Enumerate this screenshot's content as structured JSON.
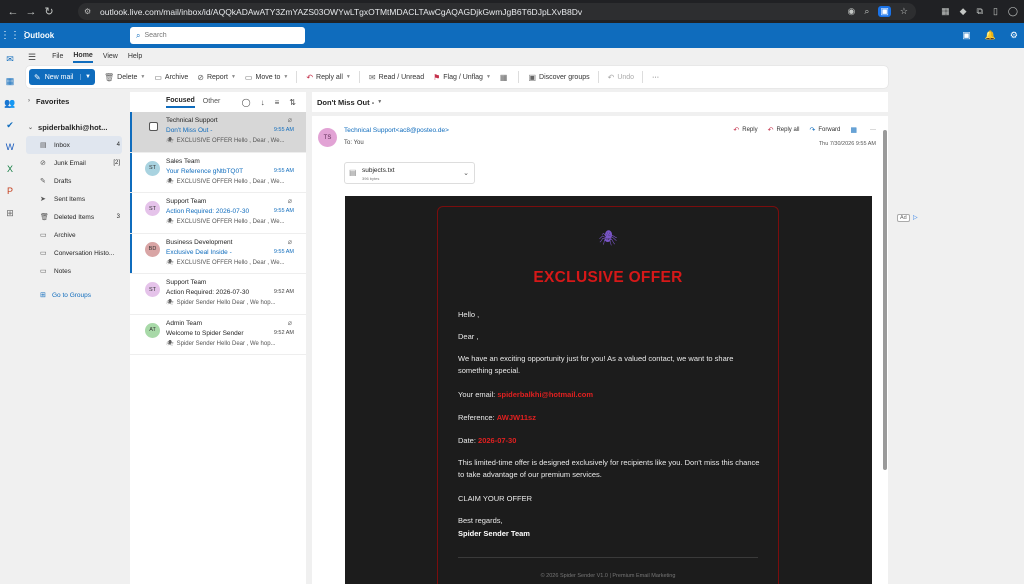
{
  "browser": {
    "url": "outlook.live.com/mail/inbox/id/AQQkADAwATY3ZmYAZS03OWYwLTgxOTMtMDACLTAwCgAQAGDjkGwmJgB6T6DJpLXvB8Dv",
    "back": "←",
    "forward": "→",
    "reload": "↻",
    "tune": "⚙"
  },
  "app": {
    "brand": "Outlook",
    "search_placeholder": "Search"
  },
  "menu_tabs": [
    "File",
    "Home",
    "View",
    "Help"
  ],
  "toolbar": {
    "new_mail": "New mail",
    "delete": "Delete",
    "archive": "Archive",
    "report": "Report",
    "move_to": "Move to",
    "reply_all": "Reply all",
    "read_unread": "Read / Unread",
    "flag_unflag": "Flag / Unflag",
    "discover_groups": "Discover groups",
    "undo": "Undo",
    "more": "···"
  },
  "folders": {
    "favorites": "Favorites",
    "account": "spiderbalkhi@hot...",
    "items": [
      {
        "label": "Inbox",
        "count": "4",
        "icon": "inbox-icon",
        "glyph": "▤"
      },
      {
        "label": "Junk Email",
        "count": "[2]",
        "icon": "junk-icon",
        "glyph": "⊘"
      },
      {
        "label": "Drafts",
        "count": "",
        "icon": "drafts-icon",
        "glyph": "✎"
      },
      {
        "label": "Sent Items",
        "count": "",
        "icon": "sent-icon",
        "glyph": "➤"
      },
      {
        "label": "Deleted Items",
        "count": "3",
        "icon": "trash-icon",
        "glyph": "🗑"
      },
      {
        "label": "Archive",
        "count": "",
        "icon": "archive-icon",
        "glyph": "▭"
      },
      {
        "label": "Conversation Histo...",
        "count": "",
        "icon": "folder-icon",
        "glyph": "▭"
      },
      {
        "label": "Notes",
        "count": "",
        "icon": "notes-icon",
        "glyph": "▭"
      }
    ],
    "go_to_groups": "Go to Groups"
  },
  "message_list": {
    "focused": "Focused",
    "other": "Other",
    "messages": [
      {
        "initials": "",
        "from": "Technical Support",
        "subject": "Don't Miss Out -",
        "time": "9:55 AM",
        "preview": "EXCLUSIVE OFFER Hello , Dear , We...",
        "color": "#bde0f5"
      },
      {
        "initials": "ST",
        "from": "Sales Team",
        "subject": "Your Reference gNtbTQ0T",
        "time": "9:55 AM",
        "preview": "EXCLUSIVE OFFER Hello , Dear , We...",
        "color": "#a9d3e0"
      },
      {
        "initials": "ST",
        "from": "Support Team",
        "subject": "Action Required: 2026-07-30",
        "time": "9:55 AM",
        "preview": "EXCLUSIVE OFFER Hello , Dear , We...",
        "color": "#e5c3ea"
      },
      {
        "initials": "BD",
        "from": "Business Development",
        "subject": "Exclusive Deal Inside -",
        "time": "9:55 AM",
        "preview": "EXCLUSIVE OFFER Hello , Dear , We...",
        "color": "#d9a5a5"
      },
      {
        "initials": "ST",
        "from": "Support Team",
        "subject": "Action Required: 2026-07-30",
        "time": "9:52 AM",
        "preview": "Spider Sender Hello Dear , We hop...",
        "color": "#e5c3ea"
      },
      {
        "initials": "AT",
        "from": "Admin Team",
        "subject": "Welcome to Spider Sender",
        "time": "9:52 AM",
        "preview": "Spider Sender Hello Dear , We hop...",
        "color": "#a8d9a8"
      }
    ]
  },
  "reading": {
    "title": "Don't Miss Out -",
    "sender_initials": "TS",
    "sender": "Technical Support<ac8@posteo.de>",
    "to_label": "To:",
    "to": "You",
    "reply": "Reply",
    "reply_all": "Reply all",
    "forward": "Forward",
    "date": "Thu 7/30/2026 9:55 AM",
    "attachment_name": "subjects.txt",
    "attachment_size": "396 bytes"
  },
  "email": {
    "spider": "🕷",
    "headline": "EXCLUSIVE OFFER",
    "hello": "Hello ,",
    "dear": "Dear ,",
    "para1": "We have an exciting opportunity just for you! As a valued contact, we want to share something special.",
    "email_label": "Your email:",
    "email_value": "spiderbalkhi@hotmail.com",
    "ref_label": "Reference:",
    "ref_value": "AWJW11sz",
    "date_label": "Date:",
    "date_value": "2026-07-30",
    "para2": "This limited-time offer is designed exclusively for recipients like you. Don't miss this chance to take advantage of our premium services.",
    "cta": "CLAIM YOUR OFFER",
    "regards": "Best regards,",
    "signature": "Spider Sender Team",
    "footer": "© 2026 Spider Sender V1.0 | Premium Email Marketing"
  },
  "ad": "Ad",
  "ad_arrow": "▷"
}
